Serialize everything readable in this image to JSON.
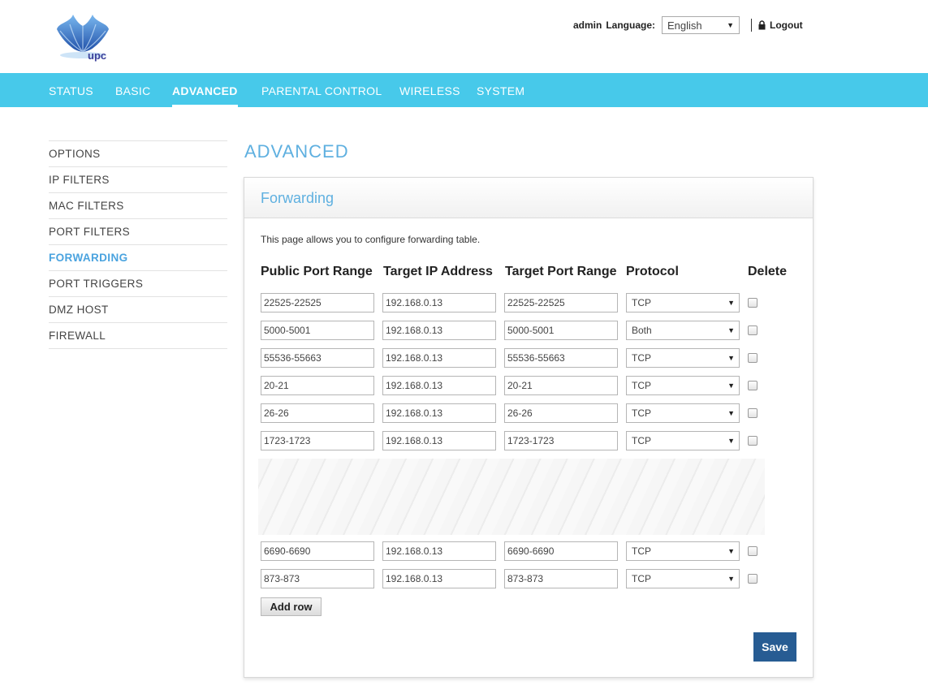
{
  "header": {
    "logo_text": "upc",
    "user": "admin",
    "language_label": "Language:",
    "language_value": "English",
    "logout_label": "Logout"
  },
  "nav": [
    {
      "label": "STATUS",
      "active": false
    },
    {
      "label": "BASIC",
      "active": false
    },
    {
      "label": "ADVANCED",
      "active": true
    },
    {
      "label": "PARENTAL CONTROL",
      "active": false
    },
    {
      "label": "WIRELESS",
      "active": false
    },
    {
      "label": "SYSTEM",
      "active": false
    }
  ],
  "sidebar": [
    {
      "label": "OPTIONS",
      "active": false
    },
    {
      "label": "IP FILTERS",
      "active": false
    },
    {
      "label": "MAC FILTERS",
      "active": false
    },
    {
      "label": "PORT FILTERS",
      "active": false
    },
    {
      "label": "FORWARDING",
      "active": true
    },
    {
      "label": "PORT TRIGGERS",
      "active": false
    },
    {
      "label": "DMZ HOST",
      "active": false
    },
    {
      "label": "FIREWALL",
      "active": false
    }
  ],
  "main": {
    "page_title": "ADVANCED",
    "panel_title": "Forwarding",
    "intro": "This page allows you to configure forwarding table.",
    "columns": [
      "Public Port Range",
      "Target IP Address",
      "Target Port Range",
      "Protocol",
      "Delete"
    ],
    "rows": [
      {
        "public": "22525-22525",
        "ip": "192.168.0.13",
        "target": "22525-22525",
        "protocol": "TCP",
        "delete": false
      },
      {
        "public": "5000-5001",
        "ip": "192.168.0.13",
        "target": "5000-5001",
        "protocol": "Both",
        "delete": false
      },
      {
        "public": "55536-55663",
        "ip": "192.168.0.13",
        "target": "55536-55663",
        "protocol": "TCP",
        "delete": false
      },
      {
        "public": "20-21",
        "ip": "192.168.0.13",
        "target": "20-21",
        "protocol": "TCP",
        "delete": false
      },
      {
        "public": "26-26",
        "ip": "192.168.0.13",
        "target": "26-26",
        "protocol": "TCP",
        "delete": false
      },
      {
        "public": "1723-1723",
        "ip": "192.168.0.13",
        "target": "1723-1723",
        "protocol": "TCP",
        "delete": false
      },
      {
        "public": "6690-6690",
        "ip": "192.168.0.13",
        "target": "6690-6690",
        "protocol": "TCP",
        "delete": false
      },
      {
        "public": "873-873",
        "ip": "192.168.0.13",
        "target": "873-873",
        "protocol": "TCP",
        "delete": false
      }
    ],
    "add_row_label": "Add row",
    "save_label": "Save"
  },
  "colors": {
    "nav_bg": "#47c9ea",
    "accent_text": "#5fb0e0",
    "save_bg": "#275c93"
  },
  "icons": {
    "logo": "upc-tulip-logo-icon",
    "logout": "padlock-icon",
    "select_arrow": "dropdown-arrow-icon"
  }
}
